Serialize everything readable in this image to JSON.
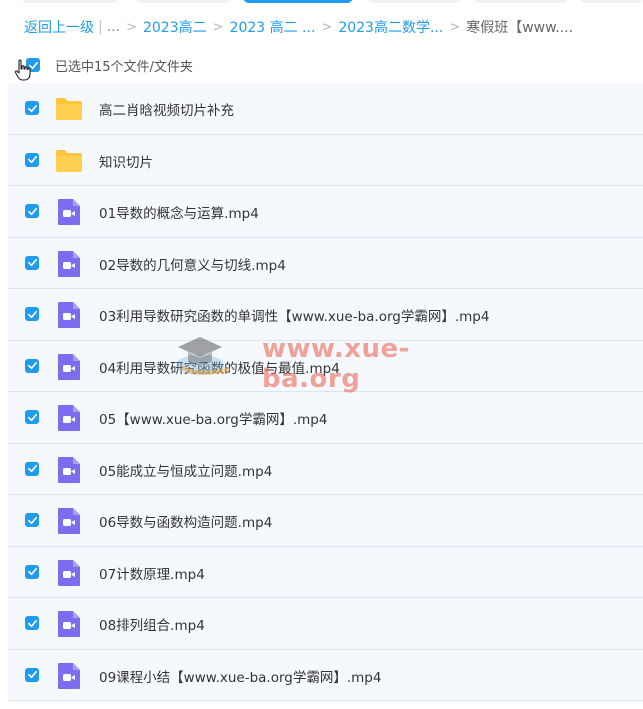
{
  "breadcrumb": {
    "back": "返回上一级",
    "items": [
      "2023高二",
      "2023 高二 ...",
      "2023高二数学..."
    ],
    "current": "寒假班【www...."
  },
  "selection": {
    "text": "已选中15个文件/文件夹"
  },
  "files": [
    {
      "name": "高二肖晗视频切片补充",
      "type": "folder"
    },
    {
      "name": "知识切片",
      "type": "folder"
    },
    {
      "name": "01导数的概念与运算.mp4",
      "type": "video"
    },
    {
      "name": "02导数的几何意义与切线.mp4",
      "type": "video"
    },
    {
      "name": "03利用导数研究函数的单调性【www.xue-ba.org学霸网】.mp4",
      "type": "video"
    },
    {
      "name": "04利用导数研究函数的极值与最值.mp4",
      "type": "video"
    },
    {
      "name": "05【www.xue-ba.org学霸网】.mp4",
      "type": "video"
    },
    {
      "name": "05能成立与恒成立问题.mp4",
      "type": "video"
    },
    {
      "name": "06导数与函数构造问题.mp4",
      "type": "video"
    },
    {
      "name": "07计数原理.mp4",
      "type": "video"
    },
    {
      "name": "08排列组合.mp4",
      "type": "video"
    },
    {
      "name": "09课程小结【www.xue-ba.org学霸网】.mp4",
      "type": "video"
    }
  ],
  "watermark": {
    "text": "www.xue-ba.org"
  },
  "colors": {
    "accent": "#1f9bf0",
    "folder": "#ffc53d",
    "video": "#7b6cf0",
    "row_bg": "#f5f9fe"
  }
}
